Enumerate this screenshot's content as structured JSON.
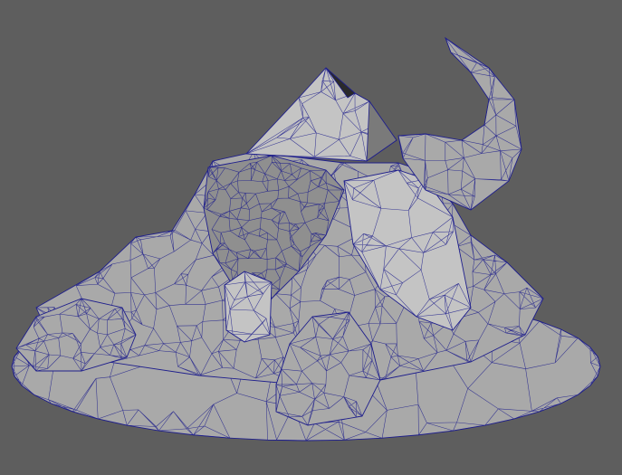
{
  "viewport": {
    "background": "#5e5e5e",
    "mesh_fill": "#a9a9a9",
    "mesh_shade": "#8f8f8f",
    "mesh_light": "#c4c4c4",
    "wire_color": "#1e1e8c"
  },
  "scene": {
    "object": "wireframe-rock-mesh",
    "parts": [
      "base-disc",
      "rock-pile",
      "pyramid-cap",
      "curved-horn",
      "boulder-left",
      "boulder-front"
    ]
  }
}
